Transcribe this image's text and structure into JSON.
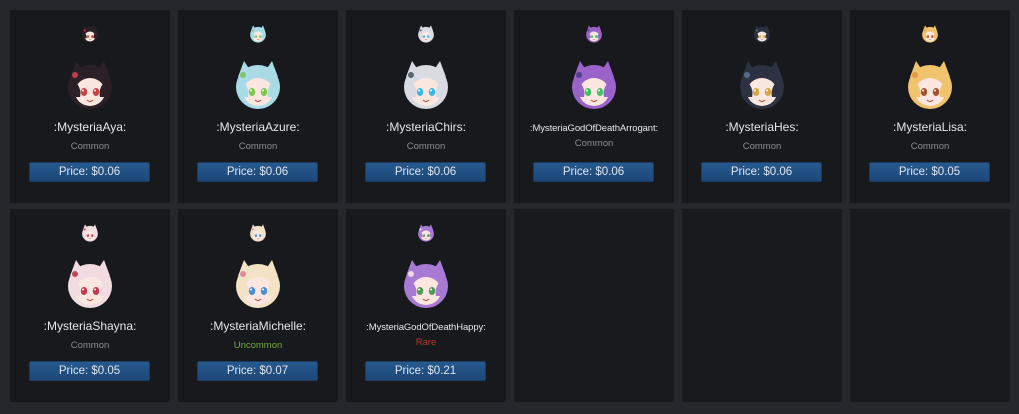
{
  "items": [
    {
      "name": ":MysteriaAya:",
      "rarity": "Common",
      "price": "Price: $0.06",
      "hair": "#2b2026",
      "accent": "#c4394a",
      "eyes": "#c94242",
      "bg": "#3b2c34"
    },
    {
      "name": ":MysteriaAzure:",
      "rarity": "Common",
      "price": "Price: $0.06",
      "hair": "#a9dbe6",
      "accent": "#7fc36b",
      "eyes": "#7dc74f",
      "bg": "#c7e7ef"
    },
    {
      "name": ":MysteriaChirs:",
      "rarity": "Common",
      "price": "Price: $0.06",
      "hair": "#d8dbe2",
      "accent": "#5e6273",
      "eyes": "#3bb8e2",
      "bg": "#e9ecf2"
    },
    {
      "name": ":MysteriaGodOfDeathArrogant:",
      "rarity": "Common",
      "price": "Price: $0.06",
      "hair": "#9a63c9",
      "accent": "#4d3d8f",
      "eyes": "#3ec465",
      "bg": "#c7a2e6"
    },
    {
      "name": ":MysteriaHes:",
      "rarity": "Common",
      "price": "Price: $0.06",
      "hair": "#2c3242",
      "accent": "#5a6b8c",
      "eyes": "#d7a545",
      "bg": "#4a546b"
    },
    {
      "name": ":MysteriaLisa:",
      "rarity": "Common",
      "price": "Price: $0.05",
      "hair": "#f0c46e",
      "accent": "#e89a3a",
      "eyes": "#a3522f",
      "bg": "#f6dfa9"
    },
    {
      "name": ":MysteriaShayna:",
      "rarity": "Common",
      "price": "Price: $0.05",
      "hair": "#f2dce2",
      "accent": "#b94a5a",
      "eyes": "#c23a4f",
      "bg": "#f6e8ec"
    },
    {
      "name": ":MysteriaMichelle:",
      "rarity": "Uncommon",
      "price": "Price: $0.07",
      "hair": "#f4e2c6",
      "accent": "#e28b9c",
      "eyes": "#4a8fd6",
      "bg": "#f8efdf"
    },
    {
      "name": ":MysteriaGodOfDeathHappy:",
      "rarity": "Rare",
      "price": "Price: $0.21",
      "hair": "#a87ad6",
      "accent": "#f2d6e6",
      "eyes": "#4d9c54",
      "bg": "#d9c2ef"
    }
  ],
  "empty_slots": 3
}
